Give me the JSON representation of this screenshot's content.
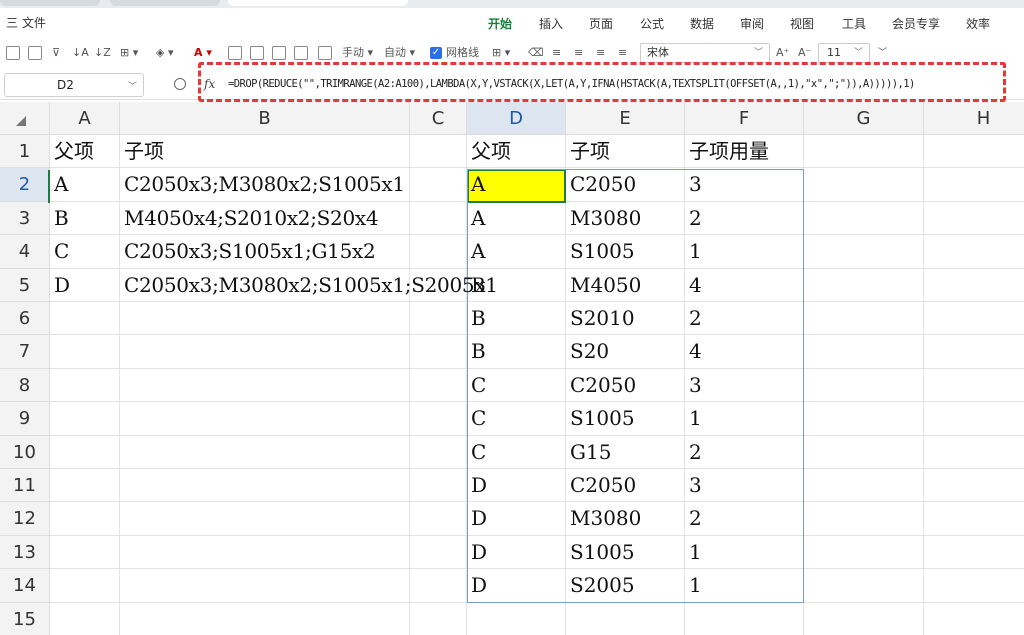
{
  "menu": {
    "file_label": "三 文件",
    "tabs": [
      "开始",
      "插入",
      "页面",
      "公式",
      "数据",
      "审阅",
      "视图",
      "工具",
      "会员专享",
      "效率"
    ],
    "active_tab": "开始"
  },
  "toolbar": {
    "manual_label": "手动",
    "auto_label": "自动",
    "gridlines_label": "网格线",
    "font_name": "宋体",
    "font_size": "11"
  },
  "formula_bar": {
    "name_box": "D2",
    "fx_label": "fx",
    "formula": "=DROP(REDUCE(\"\",TRIMRANGE(A2:A100),LAMBDA(X,Y,VSTACK(X,LET(A,Y,IFNA(HSTACK(A,TEXTSPLIT(OFFSET(A,,1),\"x\",\";\")),A))))),1)"
  },
  "sheet": {
    "columns": [
      "A",
      "B",
      "C",
      "D",
      "E",
      "F",
      "G",
      "H"
    ],
    "selected_column": "D",
    "rows": [
      "1",
      "2",
      "3",
      "4",
      "5",
      "6",
      "7",
      "8",
      "9",
      "10",
      "11",
      "12",
      "13",
      "14",
      "15"
    ],
    "selected_row": "2",
    "source_headers": [
      "父项",
      "子项"
    ],
    "source_rows": [
      [
        "A",
        "C2050x3;M3080x2;S1005x1"
      ],
      [
        "B",
        "M4050x4;S2010x2;S20x4"
      ],
      [
        "C",
        "C2050x3;S1005x1;G15x2"
      ],
      [
        "D",
        "C2050x3;M3080x2;S1005x1;S2005x1"
      ]
    ],
    "result_headers": [
      "父项",
      "子项",
      "子项用量"
    ],
    "result_rows": [
      [
        "A",
        "C2050",
        "3"
      ],
      [
        "A",
        "M3080",
        "2"
      ],
      [
        "A",
        "S1005",
        "1"
      ],
      [
        "B",
        "M4050",
        "4"
      ],
      [
        "B",
        "S2010",
        "2"
      ],
      [
        "B",
        "S20",
        "4"
      ],
      [
        "C",
        "C2050",
        "3"
      ],
      [
        "C",
        "S1005",
        "1"
      ],
      [
        "C",
        "G15",
        "2"
      ],
      [
        "D",
        "C2050",
        "3"
      ],
      [
        "D",
        "M3080",
        "2"
      ],
      [
        "D",
        "S1005",
        "1"
      ],
      [
        "D",
        "S2005",
        "1"
      ]
    ]
  },
  "colors": {
    "accent_green": "#1a7f3c",
    "highlight_yellow": "#ffff00",
    "annotation_red": "#e53935"
  }
}
